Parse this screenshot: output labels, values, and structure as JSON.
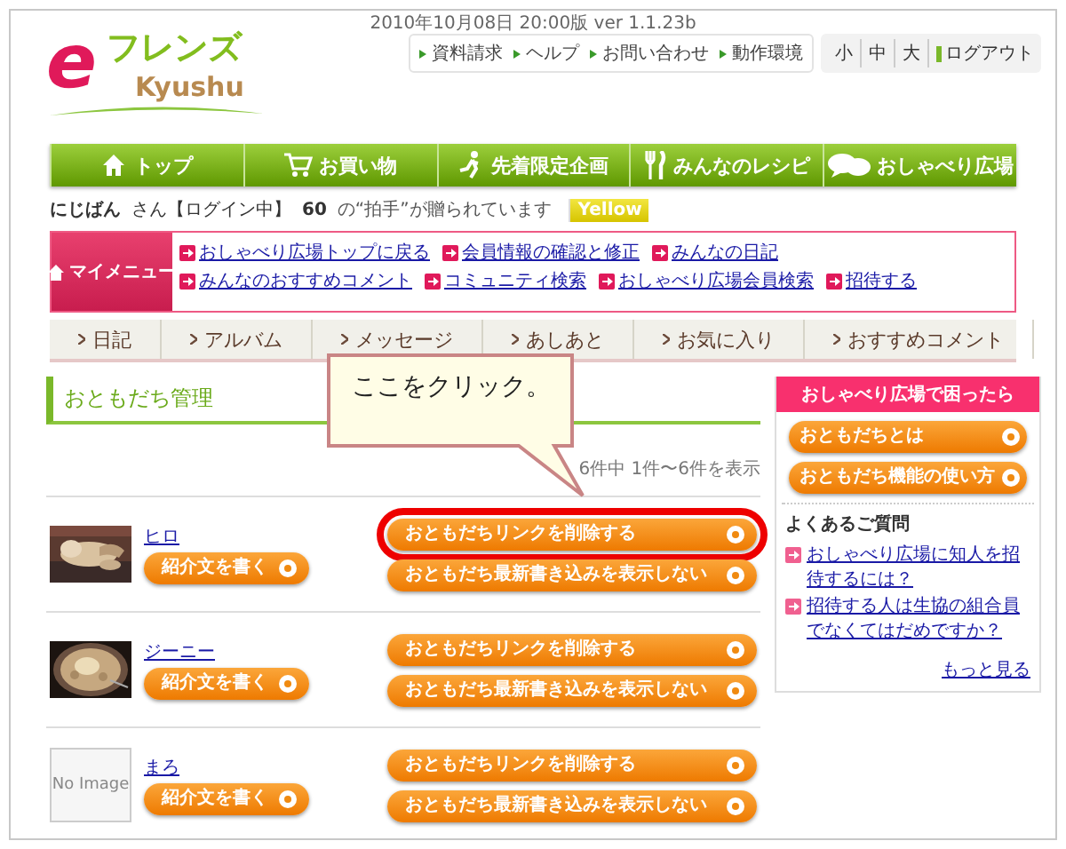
{
  "header": {
    "date_line": "2010年10月08日 20:00版 ver 1.1.23b",
    "logo": {
      "mark": "e",
      "name": "フレンズ",
      "sub": "Kyushu"
    },
    "utility_links": [
      "資料請求",
      "ヘルプ",
      "お問い合わせ",
      "動作環境"
    ],
    "font_sizes": [
      "小",
      "中",
      "大"
    ],
    "logout": "ログアウト"
  },
  "nav": [
    "トップ",
    "お買い物",
    "先着限定企画",
    "みんなのレシピ",
    "おしゃべり広場"
  ],
  "user_bar": {
    "name": "にじばん",
    "status": "さん【ログイン中】",
    "count": "60",
    "count_text": "の“拍手”が贈られています",
    "badge": "Yellow"
  },
  "my_menu": {
    "title": "マイメニュー",
    "links": [
      "おしゃべり広場トップに戻る",
      "会員情報の確認と修正",
      "みんなの日記",
      "みんなのおすすめコメント",
      "コミュニティ検索",
      "おしゃべり広場会員検索",
      "招待する"
    ]
  },
  "tabs": [
    "日記",
    "アルバム",
    "メッセージ",
    "あしあと",
    "お気に入り",
    "おすすめコメント"
  ],
  "section": {
    "title": "おともだち管理",
    "count_text": "6件中 1件〜6件を表示"
  },
  "callout": {
    "text": "ここをクリック。"
  },
  "friends": [
    {
      "name": "ヒロ",
      "intro_button": "紹介文を書く",
      "delete_button": "おともだちリンクを削除する",
      "hide_button": "おともだち最新書き込みを表示しない",
      "highlighted": true
    },
    {
      "name": "ジーニー",
      "intro_button": "紹介文を書く",
      "delete_button": "おともだちリンクを削除する",
      "hide_button": "おともだち最新書き込みを表示しない",
      "highlighted": false
    },
    {
      "name": "まろ",
      "photo": {
        "kind": "placeholder",
        "text": "No Image"
      },
      "intro_button": "紹介文を書く",
      "delete_button": "おともだちリンクを削除する",
      "hide_button": "おともだち最新書き込みを表示しない",
      "highlighted": false
    }
  ],
  "sidebar": {
    "title": "おしゃべり広場で困ったら",
    "buttons": [
      "おともだちとは",
      "おともだち機能の使い方"
    ],
    "faq_title": "よくあるご質問",
    "faq_links": [
      "おしゃべり広場に知人を招待するには？",
      "招待する人は生協の組合員でなくてはだめですか？"
    ],
    "more": "もっと見る"
  }
}
